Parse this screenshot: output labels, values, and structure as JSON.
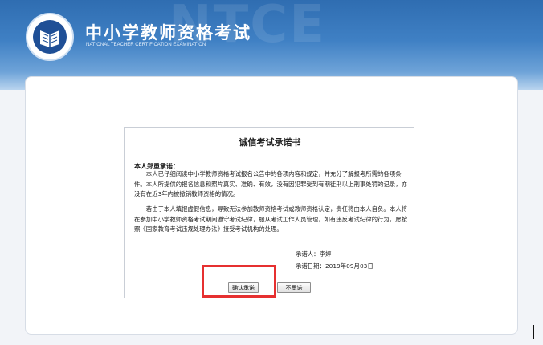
{
  "header": {
    "title": "中小学教师资格考试",
    "subtitle": "NATIONAL TEACHER CERTIFICATION EXAMINATION",
    "watermark": "NTCE"
  },
  "pledge": {
    "title": "诚信考试承诺书",
    "heading": "本人郑重承诺：",
    "paragraph1": "本人已仔细阅读中小学教师资格考试报名公告中的各项内容和规定，并充分了解报考所需的各项条件。本人所提供的报名信息和照片真实、准确、有效，没有因犯罪受到有期徒刑以上刑事处罚的记录，亦没有在近3年内被撤销教师资格的情况。",
    "paragraph2": "若由于本人填报虚假信息，导致无法参加教师资格考试或教师资格认定，责任将由本人自负。本人将在参加中小学教师资格考试期间遵守考试纪律，服从考试工作人员管理，如有违反考试纪律的行为，愿按照《国家教育考试违规处理办法》接受考试机构的处理。",
    "signer": "承诺人：李婷",
    "date": "承诺日期：2019年09月03日",
    "confirm_label": "确认承诺",
    "decline_label": "不承诺"
  },
  "colors": {
    "banner": "#3f80c4",
    "highlight": "#e63030"
  }
}
